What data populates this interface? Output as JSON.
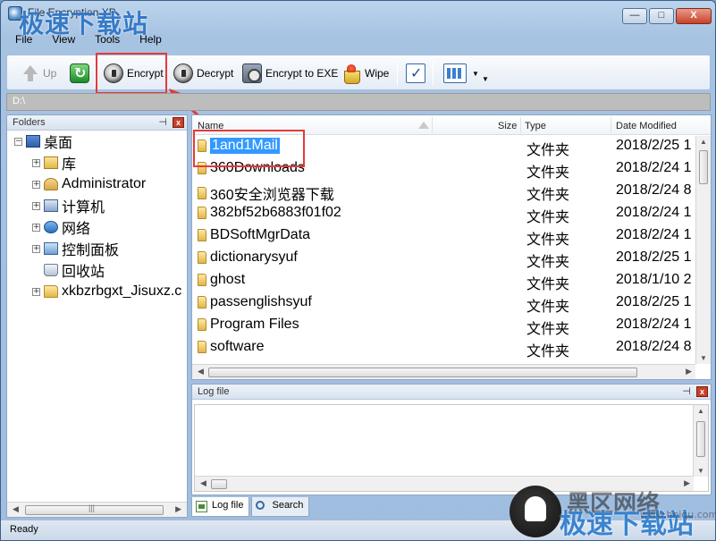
{
  "window": {
    "title": "File Encryption XP",
    "watermark_top": "极速下载站",
    "caption_buttons": {
      "minimize": "—",
      "maximize": "□",
      "close": "X"
    }
  },
  "menu": [
    "File",
    "View",
    "Tools",
    "Help"
  ],
  "toolbar": {
    "up": "Up",
    "encrypt": "Encrypt",
    "decrypt": "Decrypt",
    "encrypt_exe": "Encrypt to EXE",
    "wipe": "Wipe"
  },
  "path": "D:\\",
  "folders_panel": {
    "title": "Folders",
    "items": [
      {
        "label": "桌面",
        "icon": "desktop-icon",
        "level": 0,
        "expander": "−"
      },
      {
        "label": "库",
        "icon": "library-icon",
        "level": 1,
        "expander": "+"
      },
      {
        "label": "Administrator",
        "icon": "user-icon",
        "level": 1,
        "expander": "+"
      },
      {
        "label": "计算机",
        "icon": "computer-icon",
        "level": 1,
        "expander": "+"
      },
      {
        "label": "网络",
        "icon": "network-icon",
        "level": 1,
        "expander": "+"
      },
      {
        "label": "控制面板",
        "icon": "control-panel-icon",
        "level": 1,
        "expander": "+"
      },
      {
        "label": "回收站",
        "icon": "recycle-bin-icon",
        "level": 1,
        "expander": ""
      },
      {
        "label": "xkbzrbgxt_Jisuxz.c",
        "icon": "folder-icon",
        "level": 1,
        "expander": "+"
      }
    ]
  },
  "file_list": {
    "columns": {
      "name": "Name",
      "size": "Size",
      "type": "Type",
      "date": "Date Modified"
    },
    "rows": [
      {
        "name": "1and1Mail",
        "type": "文件夹",
        "date": "2018/2/25 1",
        "selected": true
      },
      {
        "name": "360Downloads",
        "type": "文件夹",
        "date": "2018/2/24 1"
      },
      {
        "name": "360安全浏览器下载",
        "type": "文件夹",
        "date": "2018/2/24 8"
      },
      {
        "name": "382bf52b6883f01f02",
        "type": "文件夹",
        "date": "2018/2/24 1"
      },
      {
        "name": "BDSoftMgrData",
        "type": "文件夹",
        "date": "2018/2/24 1"
      },
      {
        "name": "dictionarysyuf",
        "type": "文件夹",
        "date": "2018/2/25 1"
      },
      {
        "name": "ghost",
        "type": "文件夹",
        "date": "2018/1/10 2"
      },
      {
        "name": "passenglishsyuf",
        "type": "文件夹",
        "date": "2018/2/25 1"
      },
      {
        "name": "Program Files",
        "type": "文件夹",
        "date": "2018/2/24 1"
      },
      {
        "name": "software",
        "type": "文件夹",
        "date": "2018/2/24 8"
      }
    ]
  },
  "log_panel": {
    "title": "Log file"
  },
  "tabs": [
    {
      "label": "Log file",
      "active": true
    },
    {
      "label": "Search",
      "active": false
    }
  ],
  "status": "Ready",
  "watermark_bottom": {
    "line1": "黑区网络",
    "line2": "极速下载站",
    "url": "www.heiqu.com"
  }
}
